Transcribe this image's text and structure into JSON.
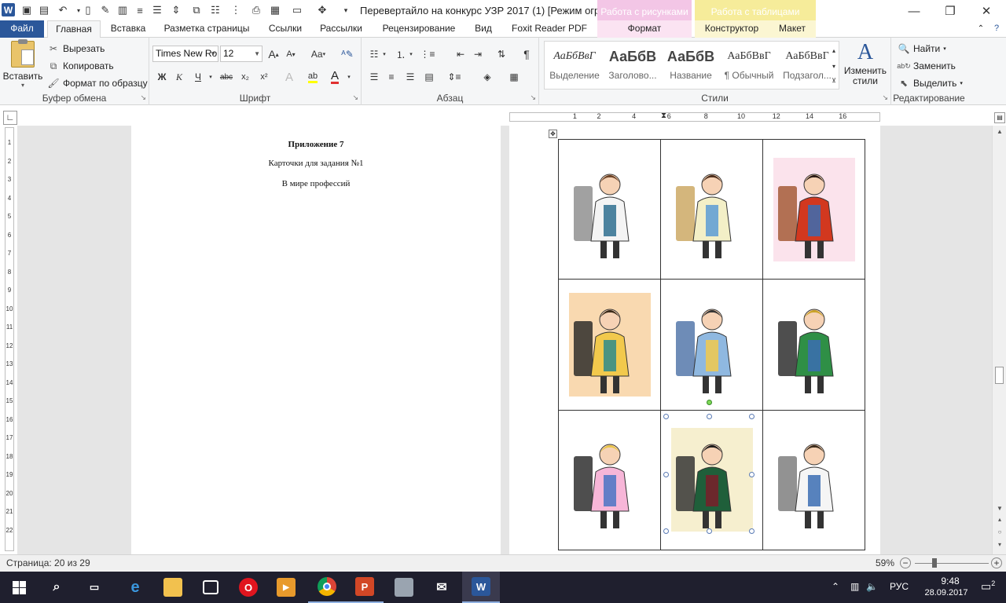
{
  "title_bar": {
    "document_title": "Перевертайло на конкурс УЗР 2017 (1) [Режим огр...",
    "context_pictures": "Работа с рисунками",
    "context_tables": "Работа с таблицами",
    "qat_icons": [
      "save-icon",
      "undo-icon",
      "new-document-icon",
      "open-icon",
      "print-icon",
      "align-icon",
      "paragraph-icon",
      "customize-icon"
    ],
    "window_buttons": [
      "minimize",
      "maximize",
      "close"
    ]
  },
  "tabs": {
    "file": "Файл",
    "home": "Главная",
    "insert": "Вставка",
    "page_layout": "Разметка страницы",
    "references": "Ссылки",
    "mailings": "Рассылки",
    "review": "Рецензирование",
    "view": "Вид",
    "foxit": "Foxit Reader PDF",
    "format": "Формат",
    "constructor": "Конструктор",
    "layout": "Макет"
  },
  "clipboard": {
    "paste": "Вставить",
    "cut": "Вырезать",
    "copy": "Копировать",
    "format_painter": "Формат по образцу",
    "label": "Буфер обмена"
  },
  "font": {
    "name": "Times New Ro",
    "size": "12",
    "label": "Шрифт",
    "bold": "Ж",
    "italic": "К",
    "underline": "Ч",
    "strike": "abc",
    "subscript": "x₂",
    "superscript": "x²",
    "grow": "A",
    "shrink": "A",
    "case": "Aa",
    "font_color": "A",
    "highlight": "ab"
  },
  "paragraph": {
    "label": "Абзац"
  },
  "styles": {
    "label": "Стили",
    "items": [
      {
        "sample": "АаБбВвГ",
        "name": "Выделение"
      },
      {
        "sample": "АаБбВ",
        "name": "Заголово..."
      },
      {
        "sample": "АаБбВ",
        "name": "Название"
      },
      {
        "sample": "АаБбВвГ",
        "name": "¶ Обычный"
      },
      {
        "sample": "АаБбВвГ",
        "name": "Подзагол..."
      }
    ],
    "change_styles": "Изменить стили"
  },
  "editing": {
    "label": "Редактирование",
    "find": "Найти",
    "replace": "Заменить",
    "select": "Выделить"
  },
  "ruler": {
    "marks": [
      "1",
      "2",
      "4",
      "6",
      "8",
      "10",
      "12",
      "14",
      "16"
    ],
    "vertical_marks": [
      "1",
      "2",
      "3",
      "4",
      "5",
      "6",
      "7",
      "8",
      "9",
      "10",
      "11",
      "12",
      "13",
      "14",
      "15",
      "16",
      "17",
      "18",
      "19",
      "20",
      "21",
      "22"
    ]
  },
  "document": {
    "appendix": "Приложение 7",
    "cards_title": "Карточки для задания №1",
    "subtitle": "В мире профессий",
    "cards": [
      [
        "pharmacist-icon",
        "hairdresser-icon",
        "seamstress-icon"
      ],
      [
        "tailor-icon",
        "dentist-icon",
        "teacher-icon"
      ],
      [
        "cleaner-icon",
        "fashion-designer-icon",
        "chef-icon"
      ]
    ]
  },
  "status": {
    "page": "Страница: 20 из 29",
    "zoom": "59%",
    "zoom_level": 0.59
  },
  "taskbar": {
    "apps": [
      "start-icon",
      "search-icon",
      "task-view-icon",
      "edge-icon",
      "explorer-icon",
      "store-icon",
      "opera-icon",
      "media-icon",
      "chrome-icon",
      "powerpoint-icon",
      "scanner-icon",
      "mail-icon",
      "word-icon"
    ],
    "language": "РУС",
    "time": "9:48",
    "date": "28.09.2017",
    "notifications": "2"
  },
  "colors": {
    "word_blue": "#2b579a",
    "context_pictures": "#f3c6e6",
    "context_tables": "#f6ec9a",
    "taskbar": "#1f1f2e"
  }
}
